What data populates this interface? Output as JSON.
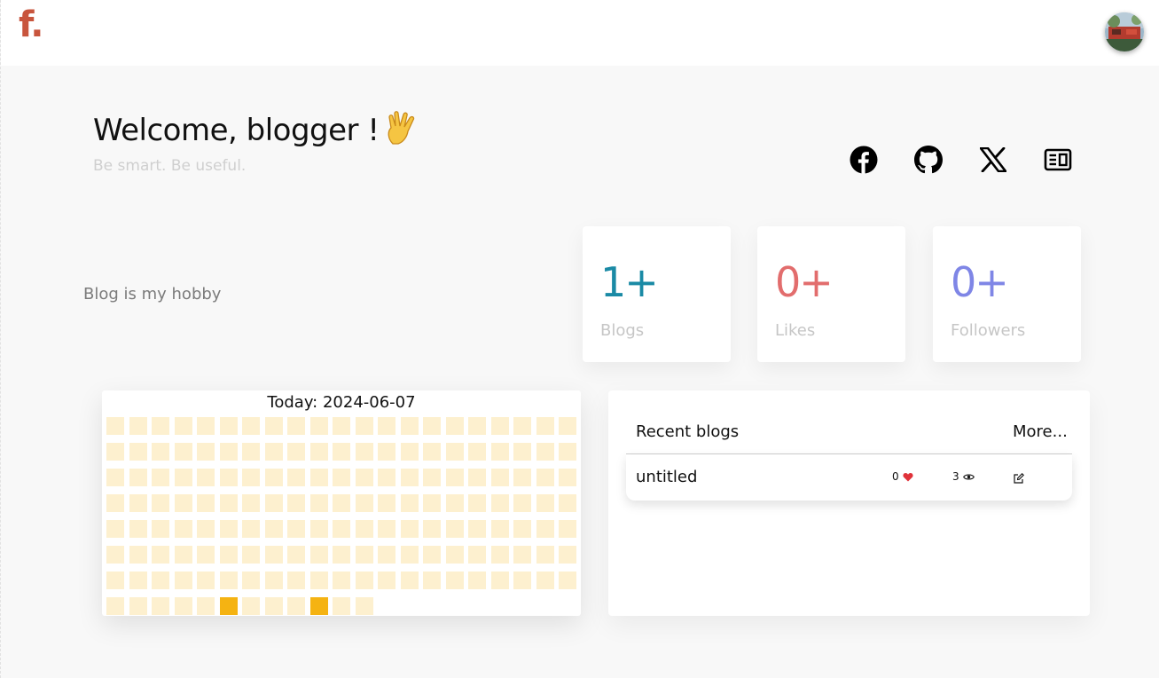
{
  "header": {
    "logo_text": "f.",
    "avatar_alt": "user-avatar"
  },
  "welcome": {
    "title": "Welcome, blogger !",
    "emoji_icon": "vulcan-salute-icon",
    "subtitle": "Be smart. Be useful."
  },
  "social_links": [
    {
      "name": "facebook-icon"
    },
    {
      "name": "github-icon"
    },
    {
      "name": "x-icon"
    },
    {
      "name": "blog-icon"
    }
  ],
  "bio": "Blog is my hobby",
  "stats": [
    {
      "value": "1+",
      "label": "Blogs",
      "color": "#1a8aa5"
    },
    {
      "value": "0+",
      "label": "Likes",
      "color": "#e26d6d"
    },
    {
      "value": "0+",
      "label": "Followers",
      "color": "#7f86e6"
    }
  ],
  "calendar": {
    "title": "Today: 2024-06-07",
    "cell_color": "#fdf0cf",
    "active_color": "#f5b312",
    "columns": 21,
    "rows": 8,
    "last_row_count": 12,
    "active_cells": [
      [
        7,
        5
      ],
      [
        7,
        9
      ]
    ]
  },
  "recent": {
    "title": "Recent blogs",
    "more_label": "More...",
    "rows": [
      {
        "title": "untitled",
        "likes": "0",
        "views": "3"
      }
    ]
  }
}
